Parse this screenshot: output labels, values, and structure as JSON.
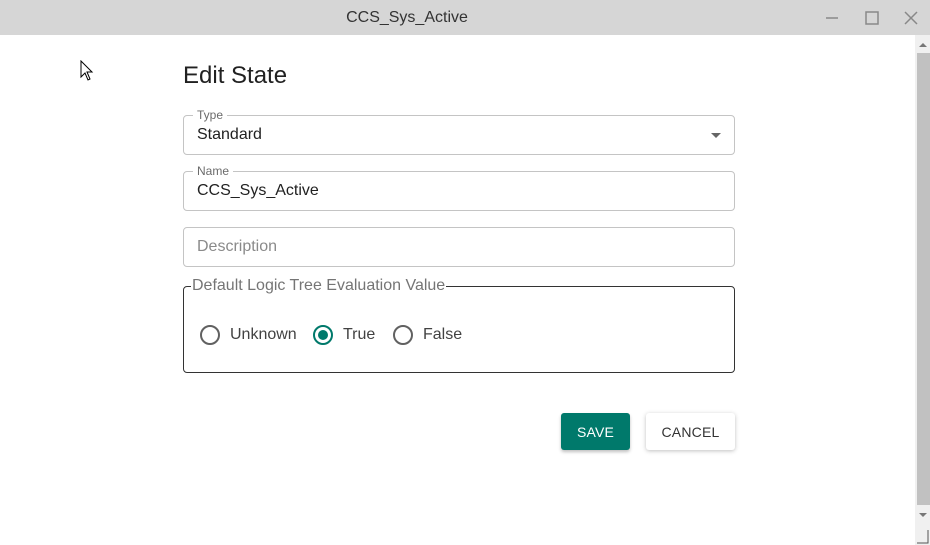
{
  "window": {
    "title": "CCS_Sys_Active",
    "icons": {
      "minimize": "minimize-icon",
      "maximize": "maximize-icon",
      "close": "close-icon"
    }
  },
  "dialog": {
    "heading": "Edit State",
    "type_field": {
      "label": "Type",
      "value": "Standard"
    },
    "name_field": {
      "label": "Name",
      "value": "CCS_Sys_Active"
    },
    "description_field": {
      "placeholder": "Description",
      "value": ""
    },
    "evaluation": {
      "legend": "Default Logic Tree Evaluation Value",
      "options": [
        "Unknown",
        "True",
        "False"
      ],
      "selected": "True"
    },
    "buttons": {
      "save": "SAVE",
      "cancel": "CANCEL"
    }
  },
  "colors": {
    "accent": "#00796b",
    "titlebar": "#d6d6d6"
  }
}
